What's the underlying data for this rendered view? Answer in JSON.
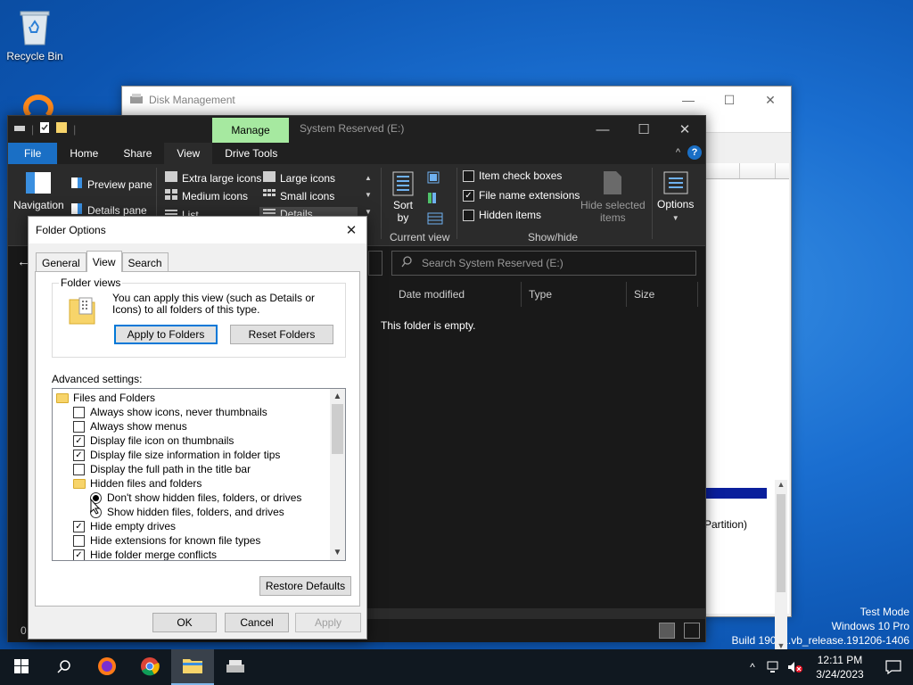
{
  "desktop": {
    "recycle_bin_label": "Recycle Bin",
    "watermark": {
      "line1": "Test Mode",
      "line2": "Windows 10 Pro",
      "line3": "Build 19041.vb_release.191206-1406"
    }
  },
  "disk_management": {
    "title": "Disk Management",
    "partition_text": "Partition)"
  },
  "explorer": {
    "title": "System Reserved (E:)",
    "manage_tab": "Manage",
    "tabs": [
      "File",
      "Home",
      "Share",
      "View",
      "Drive Tools"
    ],
    "active_tab": "View",
    "ribbon": {
      "navigation_pane": "Navigation",
      "preview_pane": "Preview pane",
      "details_pane": "Details pane",
      "layout": {
        "extra_large_icons": "Extra large icons",
        "large_icons": "Large icons",
        "medium_icons": "Medium icons",
        "small_icons": "Small icons",
        "list": "List",
        "details": "Details"
      },
      "sort_by": "Sort",
      "sort_by2": "by",
      "current_view_label": "Current view",
      "item_check_boxes": "Item check boxes",
      "file_name_extensions": "File name extensions",
      "hidden_items": "Hidden items",
      "hide_selected_items": "Hide selected",
      "hide_selected_items2": "items",
      "options": "Options",
      "show_hide_label": "Show/hide"
    },
    "search_placeholder": "Search System Reserved (E:)",
    "columns": [
      "Date modified",
      "Type",
      "Size"
    ],
    "empty_message": "This folder is empty.",
    "status_count": "0"
  },
  "folder_options": {
    "title": "Folder Options",
    "tabs": [
      "General",
      "View",
      "Search"
    ],
    "active_tab": "View",
    "folder_views": {
      "legend": "Folder views",
      "description": "You can apply this view (such as Details or Icons) to all folders of this type.",
      "apply_button": "Apply to Folders",
      "reset_button": "Reset Folders"
    },
    "advanced_label": "Advanced settings:",
    "advanced_items": [
      {
        "kind": "folder",
        "label": "Files and Folders",
        "level": 0
      },
      {
        "kind": "checkbox",
        "label": "Always show icons, never thumbnails",
        "checked": false,
        "level": 1
      },
      {
        "kind": "checkbox",
        "label": "Always show menus",
        "checked": false,
        "level": 1
      },
      {
        "kind": "checkbox",
        "label": "Display file icon on thumbnails",
        "checked": true,
        "level": 1
      },
      {
        "kind": "checkbox",
        "label": "Display file size information in folder tips",
        "checked": true,
        "level": 1
      },
      {
        "kind": "checkbox",
        "label": "Display the full path in the title bar",
        "checked": false,
        "level": 1
      },
      {
        "kind": "folder",
        "label": "Hidden files and folders",
        "level": 1
      },
      {
        "kind": "radio",
        "label": "Don't show hidden files, folders, or drives",
        "checked": true,
        "level": 2
      },
      {
        "kind": "radio",
        "label": "Show hidden files, folders, and drives",
        "checked": false,
        "level": 2
      },
      {
        "kind": "checkbox",
        "label": "Hide empty drives",
        "checked": true,
        "level": 1
      },
      {
        "kind": "checkbox",
        "label": "Hide extensions for known file types",
        "checked": false,
        "level": 1
      },
      {
        "kind": "checkbox",
        "label": "Hide folder merge conflicts",
        "checked": true,
        "level": 1
      }
    ],
    "restore_defaults": "Restore Defaults",
    "ok": "OK",
    "cancel": "Cancel",
    "apply": "Apply"
  },
  "taskbar": {
    "time": "12:11 PM",
    "date": "3/24/2023"
  },
  "colors": {
    "accent": "#0078d7",
    "manage_tab": "#a6e9a0",
    "file_tab": "#1a6fc5"
  }
}
